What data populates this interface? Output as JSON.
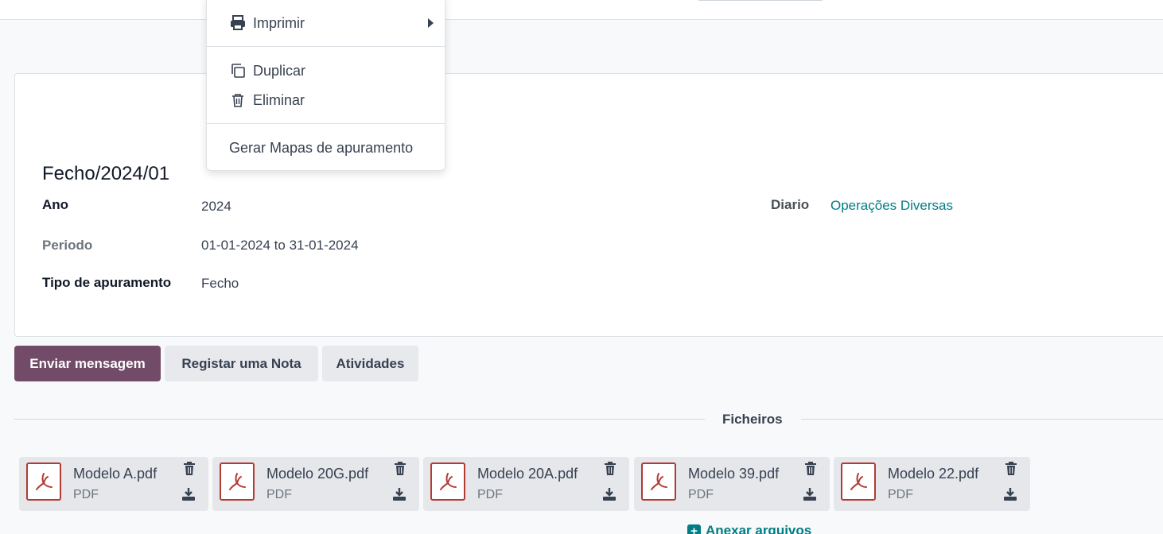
{
  "record": {
    "title": "Fecho/2024/01",
    "fields": {
      "ano_label": "Ano",
      "ano_value": "2024",
      "periodo_label": "Periodo",
      "periodo_value": "01-01-2024 to 31-01-2024",
      "tipo_label": "Tipo de apuramento",
      "tipo_value": "Fecho",
      "diario_label": "Diario",
      "diario_value": "Operações Diversas"
    }
  },
  "dropdown": {
    "items": [
      {
        "label": "Imprimir",
        "icon": "printer-icon"
      },
      {
        "label": "Duplicar",
        "icon": "copy-icon"
      },
      {
        "label": "Eliminar",
        "icon": "trash-icon"
      },
      {
        "label": "Gerar Mapas de apuramento"
      }
    ]
  },
  "chatter": {
    "send_message": "Enviar mensagem",
    "log_note": "Registar uma Nota",
    "activities": "Atividades",
    "files_label": "Ficheiros",
    "attach_files": "Anexar arquivos"
  },
  "attachments": [
    {
      "name": "Modelo A.pdf",
      "type": "PDF"
    },
    {
      "name": "Modelo 20G.pdf",
      "type": "PDF"
    },
    {
      "name": "Modelo 20A.pdf",
      "type": "PDF"
    },
    {
      "name": "Modelo 39.pdf",
      "type": "PDF"
    },
    {
      "name": "Modelo 22.pdf",
      "type": "PDF"
    }
  ],
  "colors": {
    "primary": "#714b67",
    "link": "#017e84",
    "pdf": "#b23b34"
  }
}
